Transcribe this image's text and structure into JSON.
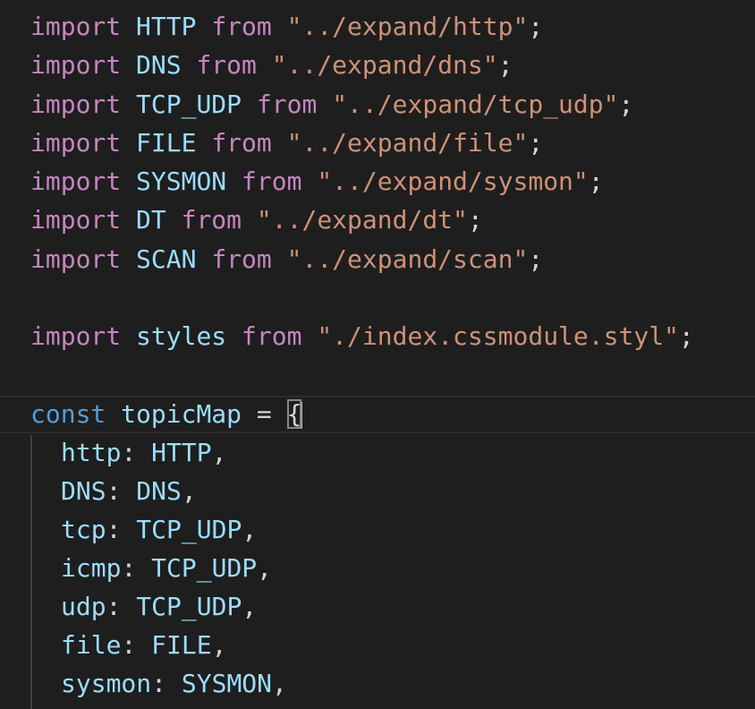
{
  "editor": {
    "imports": [
      {
        "keyword": "import",
        "name": "HTTP",
        "from": "from",
        "path": "\"../expand/http\"",
        "end": ";"
      },
      {
        "keyword": "import",
        "name": "DNS",
        "from": "from",
        "path": "\"../expand/dns\"",
        "end": ";"
      },
      {
        "keyword": "import",
        "name": "TCP_UDP",
        "from": "from",
        "path": "\"../expand/tcp_udp\"",
        "end": ";"
      },
      {
        "keyword": "import",
        "name": "FILE",
        "from": "from",
        "path": "\"../expand/file\"",
        "end": ";"
      },
      {
        "keyword": "import",
        "name": "SYSMON",
        "from": "from",
        "path": "\"../expand/sysmon\"",
        "end": ";"
      },
      {
        "keyword": "import",
        "name": "DT",
        "from": "from",
        "path": "\"../expand/dt\"",
        "end": ";"
      },
      {
        "keyword": "import",
        "name": "SCAN",
        "from": "from",
        "path": "\"../expand/scan\"",
        "end": ";"
      }
    ],
    "styles_import": {
      "keyword": "import",
      "name": "styles",
      "from": "from",
      "path": "\"./index.cssmodule.styl\"",
      "end": ";"
    },
    "const_decl": {
      "keyword": "const",
      "name": "topicMap",
      "op": "=",
      "brace": "{"
    },
    "entries": [
      {
        "key": "http",
        "value": "HTTP"
      },
      {
        "key": "DNS",
        "value": "DNS"
      },
      {
        "key": "tcp",
        "value": "TCP_UDP"
      },
      {
        "key": "icmp",
        "value": "TCP_UDP"
      },
      {
        "key": "udp",
        "value": "TCP_UDP"
      },
      {
        "key": "file",
        "value": "FILE"
      },
      {
        "key": "sysmon",
        "value": "SYSMON"
      }
    ],
    "colors": {
      "background": "#1e1e1e",
      "keyword": "#c586c0",
      "storage_keyword": "#569cd6",
      "identifier": "#9cdcfe",
      "string": "#ce9178",
      "punctuation": "#d4d4d4"
    }
  }
}
